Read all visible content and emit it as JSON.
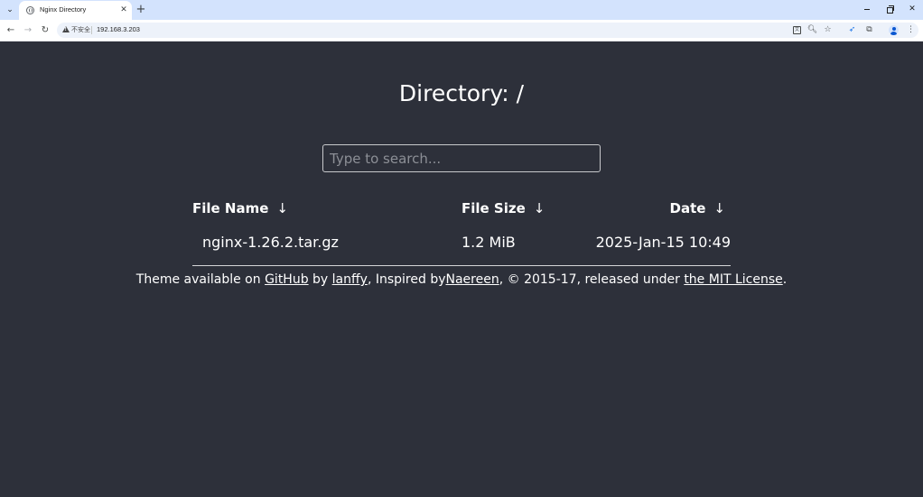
{
  "browser": {
    "tab_title": "Nginx Directory",
    "security_label": "不安全",
    "url": "192.168.3.203"
  },
  "page": {
    "heading": "Directory: /",
    "search_placeholder": "Type to search...",
    "columns": {
      "name": "File Name",
      "size": "File Size",
      "date": "Date",
      "sort_arrow": "↓"
    },
    "files": [
      {
        "name": "nginx-1.26.2.tar.gz",
        "size": "1.2 MiB",
        "date": "2025-Jan-15 10:49"
      }
    ],
    "footer": {
      "text1": "Theme available on ",
      "github": "GitHub",
      "text2": " by ",
      "author": "lanffy",
      "text3": ", Inspired by",
      "inspired": "Naereen",
      "text4": ", © 2015-17, released under ",
      "license": "the MIT License",
      "text5": "."
    }
  },
  "colors": {
    "page_background": "#2d303a",
    "tab_strip": "#d3e3fd",
    "text": "#ffffff"
  }
}
